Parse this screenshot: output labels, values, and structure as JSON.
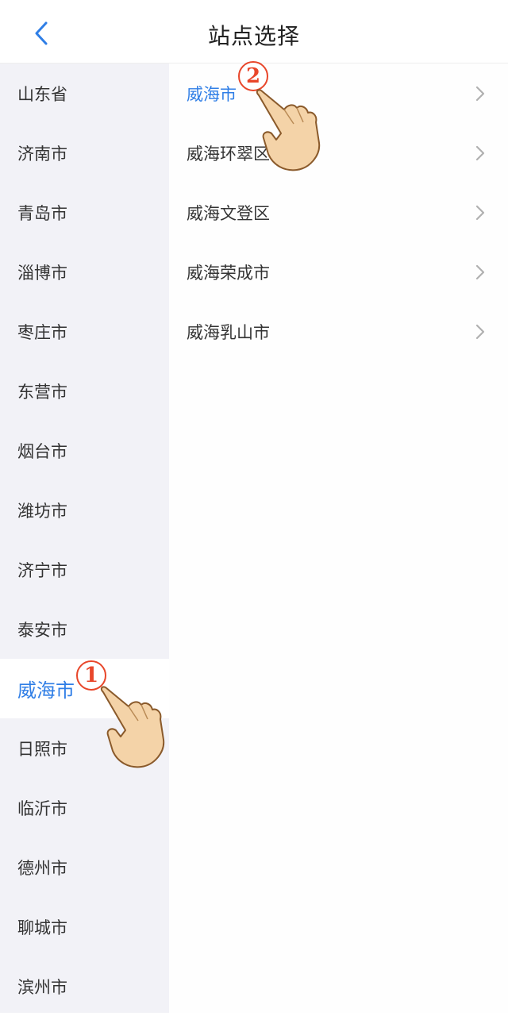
{
  "header": {
    "title": "站点选择"
  },
  "provinces": [
    {
      "label": "山东省"
    },
    {
      "label": "济南市"
    },
    {
      "label": "青岛市"
    },
    {
      "label": "淄博市"
    },
    {
      "label": "枣庄市"
    },
    {
      "label": "东营市"
    },
    {
      "label": "烟台市"
    },
    {
      "label": "潍坊市"
    },
    {
      "label": "济宁市"
    },
    {
      "label": "泰安市"
    },
    {
      "label": "威海市"
    },
    {
      "label": "日照市"
    },
    {
      "label": "临沂市"
    },
    {
      "label": "德州市"
    },
    {
      "label": "聊城市"
    },
    {
      "label": "滨州市"
    }
  ],
  "cities": [
    {
      "label": "威海市"
    },
    {
      "label": "威海环翠区"
    },
    {
      "label": "威海文登区"
    },
    {
      "label": "威海荣成市"
    },
    {
      "label": "威海乳山市"
    }
  ],
  "annotations": {
    "step1": "1",
    "step2": "2"
  },
  "colors": {
    "accent": "#2f7ee6",
    "callout": "#e8462a",
    "sidebar_bg": "#f2f2f7"
  },
  "icons": {
    "back": "chevron-left-icon",
    "row": "chevron-right-icon",
    "pointer": "pointing-hand-icon"
  }
}
